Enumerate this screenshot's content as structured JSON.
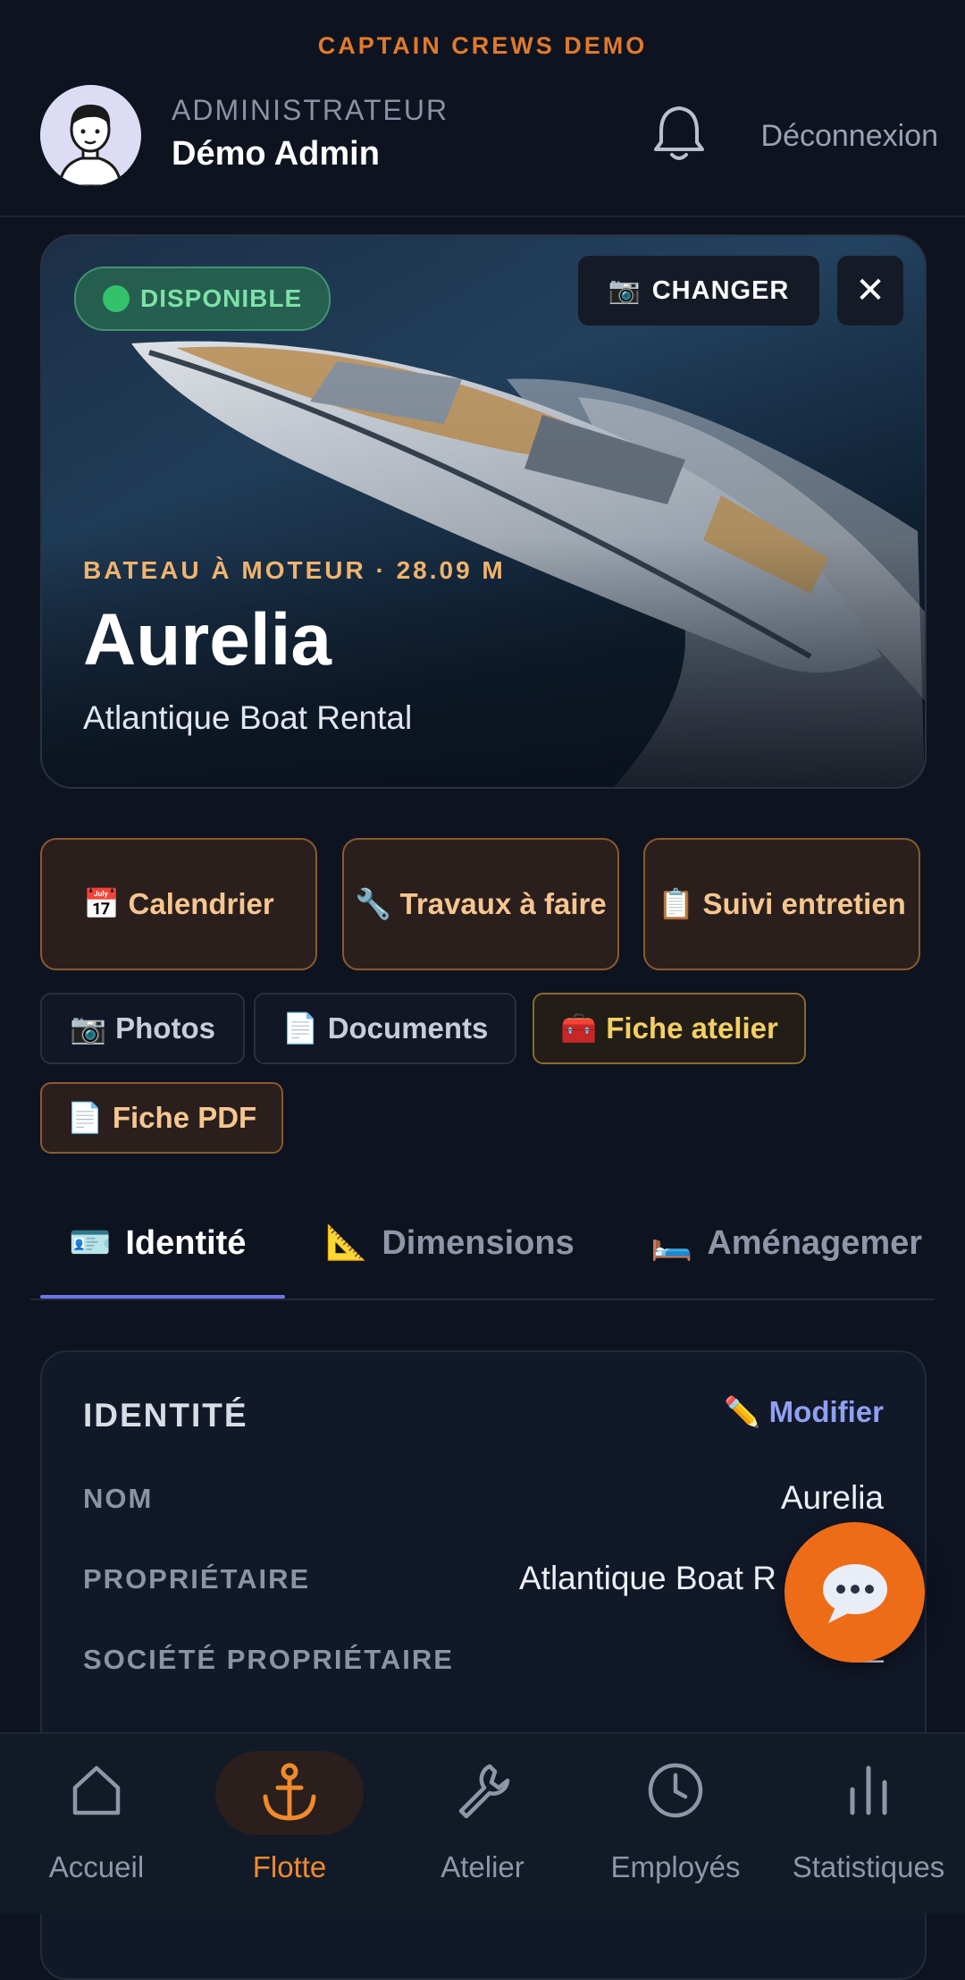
{
  "brand": "CAPTAIN CREWS DEMO",
  "header": {
    "role": "ADMINISTRATEUR",
    "user_name": "Démo Admin",
    "logout_label": "Déconnexion"
  },
  "hero": {
    "status_badge": "DISPONIBLE",
    "change_label": "CHANGER",
    "close_label": "✕",
    "boat_type": "BATEAU À MOTEUR · 28.09 M",
    "boat_name": "Aurelia",
    "owner": "Atlantique Boat Rental"
  },
  "quick_actions": [
    {
      "icon": "📅",
      "label": "Calendrier"
    },
    {
      "icon": "🔧",
      "label": "Travaux à faire"
    },
    {
      "icon": "📋",
      "label": "Suivi entretien"
    }
  ],
  "secondary_actions": [
    {
      "icon": "📷",
      "label": "Photos"
    },
    {
      "icon": "📄",
      "label": "Documents"
    },
    {
      "icon": "🧰",
      "label": "Fiche atelier"
    },
    {
      "icon": "📄",
      "label": "Fiche PDF"
    }
  ],
  "tabs": [
    {
      "icon": "🪪",
      "label": "Identité",
      "active": true
    },
    {
      "icon": "📐",
      "label": "Dimensions",
      "active": false
    },
    {
      "icon": "🛏️",
      "label": "Aménagemer",
      "active": false
    }
  ],
  "identity_card": {
    "title": "IDENTITÉ",
    "edit_label": "Modifier",
    "rows": [
      {
        "label": "NOM",
        "value": "Aurelia"
      },
      {
        "label": "PROPRIÉTAIRE",
        "value": "Atlantique Boat R"
      },
      {
        "label": "SOCIÉTÉ PROPRIÉTAIRE",
        "value": "—"
      }
    ]
  },
  "nav": [
    {
      "label": "Accueil",
      "icon": "home-icon",
      "active": false
    },
    {
      "label": "Flotte",
      "icon": "anchor-icon",
      "active": true
    },
    {
      "label": "Atelier",
      "icon": "wrench-icon",
      "active": false
    },
    {
      "label": "Employés",
      "icon": "clock-icon",
      "active": false
    },
    {
      "label": "Statistiques",
      "icon": "bar-chart-icon",
      "active": false
    }
  ],
  "colors": {
    "accent_orange": "#ee6c18",
    "brand_orange": "#e07a2c",
    "status_green": "#33c26b",
    "tab_indicator": "#6f74e6",
    "background": "#0e1320"
  }
}
